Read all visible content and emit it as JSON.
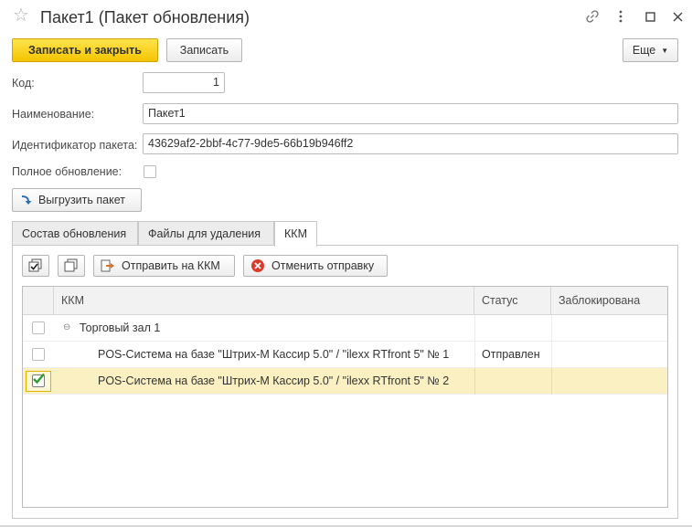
{
  "window": {
    "title": "Пакет1 (Пакет обновления)",
    "star_icon": "star-icon",
    "link_icon": "link-icon",
    "more_icon": "more-vertical-icon",
    "maximize_icon": "maximize-icon",
    "close_icon": "close-icon"
  },
  "toolbar": {
    "save_close_label": "Записать и закрыть",
    "save_label": "Записать",
    "more_label": "Еще"
  },
  "form": {
    "code_label": "Код:",
    "code_value": "1",
    "name_label": "Наименование:",
    "name_value": "Пакет1",
    "package_id_label": "Идентификатор пакета:",
    "package_id_value": "43629af2-2bbf-4c77-9de5-66b19b946ff2",
    "full_update_label": "Полное обновление:",
    "full_update_checked": false,
    "export_button_label": "Выгрузить пакет"
  },
  "tabs": [
    {
      "label": "Состав обновления",
      "active": false
    },
    {
      "label": "Файлы для удаления",
      "active": false
    },
    {
      "label": "ККМ",
      "active": true
    }
  ],
  "kkm_toolbar": {
    "send_label": "Отправить на ККМ",
    "cancel_label": "Отменить отправку"
  },
  "grid": {
    "columns": [
      "ККМ",
      "Статус",
      "Заблокирована"
    ],
    "rows": [
      {
        "type": "group",
        "checked": false,
        "name": "Торговый зал 1",
        "status": "",
        "locked": ""
      },
      {
        "type": "item",
        "checked": false,
        "name": "POS-Система на базе \"Штрих-М Кассир 5.0\" / \"ilexx RTfront 5\" № 1",
        "status": "Отправлен",
        "locked": ""
      },
      {
        "type": "item",
        "checked": true,
        "name": "POS-Система на базе \"Штрих-М Кассир 5.0\" / \"ilexx RTfront 5\" № 2",
        "status": "",
        "locked": "",
        "selected": true
      }
    ]
  },
  "colors": {
    "primary_button": "#f4c400",
    "selected_row": "#fbf0c2",
    "checkbox_check": "#2e9b2e",
    "cancel_icon": "#d83b2b"
  }
}
